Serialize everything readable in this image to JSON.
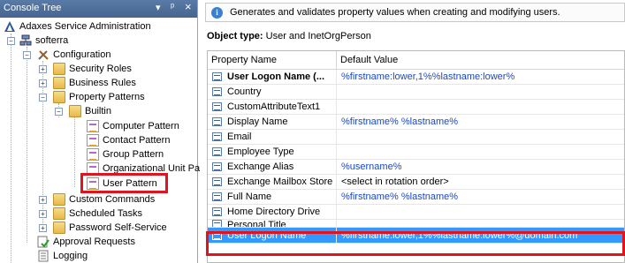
{
  "console_tree": {
    "title": "Console Tree",
    "controls": {
      "dropdown": "▾",
      "pin": "ᵖ",
      "close": "×"
    },
    "nodes": [
      {
        "label": "Adaxes Service Administration"
      },
      {
        "label": "softerra"
      },
      {
        "label": "Configuration"
      },
      {
        "label": "Security Roles"
      },
      {
        "label": "Business Rules"
      },
      {
        "label": "Property Patterns"
      },
      {
        "label": "Builtin"
      },
      {
        "label": "Computer Pattern"
      },
      {
        "label": "Contact Pattern"
      },
      {
        "label": "Group Pattern"
      },
      {
        "label": "Organizational Unit Pa"
      },
      {
        "label": "User Pattern"
      },
      {
        "label": "Custom Commands"
      },
      {
        "label": "Scheduled Tasks"
      },
      {
        "label": "Password Self-Service"
      },
      {
        "label": "Approval Requests"
      },
      {
        "label": "Logging"
      }
    ]
  },
  "info_bar": {
    "text": "Generates and validates property values when creating and modifying users."
  },
  "object_type": {
    "label": "Object type:",
    "value": "User and InetOrgPerson"
  },
  "grid": {
    "headers": {
      "property": "Property Name",
      "value": "Default Value"
    },
    "rows": [
      {
        "name": "User Logon Name (...",
        "value": "%firstname:lower,1%%lastname:lower%"
      },
      {
        "name": "Country",
        "value": ""
      },
      {
        "name": "CustomAttributeText1",
        "value": ""
      },
      {
        "name": "Display Name",
        "value": "%firstname% %lastname%"
      },
      {
        "name": "Email",
        "value": ""
      },
      {
        "name": "Employee Type",
        "value": ""
      },
      {
        "name": "Exchange Alias",
        "value": "%username%"
      },
      {
        "name": "Exchange Mailbox Store",
        "value": "<select in rotation order>"
      },
      {
        "name": "Full Name",
        "value": "%firstname% %lastname%"
      },
      {
        "name": "Home Directory Drive",
        "value": ""
      },
      {
        "name": "Personal Title",
        "value": ""
      },
      {
        "name": "User Logon Name",
        "value": "%firstname:lower,1%%lastname:lower%@domain.com"
      }
    ]
  },
  "colors": {
    "highlight_box": "#e0141e",
    "selection": "#3399ff",
    "link": "#1a49c8"
  }
}
